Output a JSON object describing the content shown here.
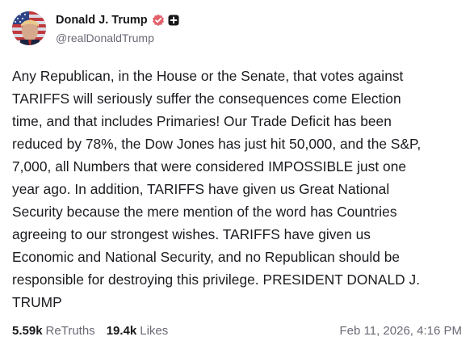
{
  "author": {
    "display_name": "Donald J. Trump",
    "handle": "@realDonaldTrump",
    "verified_color": "#e3606b"
  },
  "post": {
    "lines": [
      "Any Republican, in the House or the Senate, that votes against",
      "TARIFFS will seriously suffer the consequences come Election",
      "time, and that includes Primaries! Our Trade Deficit has been",
      "reduced by 78%, the Dow Jones has just hit 50,000, and the S&P,",
      "7,000, all Numbers that were considered IMPOSSIBLE just one",
      "year ago. In addition, TARIFFS have given us Great National",
      "Security because the mere mention of the word has Countries",
      "agreeing to our strongest wishes. TARIFFS have given us",
      "Economic and National Security, and no Republican should be",
      "responsible for destroying this privilege. PRESIDENT DONALD J.",
      "TRUMP"
    ]
  },
  "stats": {
    "retruths_count": "5.59k",
    "retruths_label": "ReTruths",
    "likes_count": "19.4k",
    "likes_label": "Likes"
  },
  "timestamp": "Feb 11, 2026, 4:16 PM"
}
